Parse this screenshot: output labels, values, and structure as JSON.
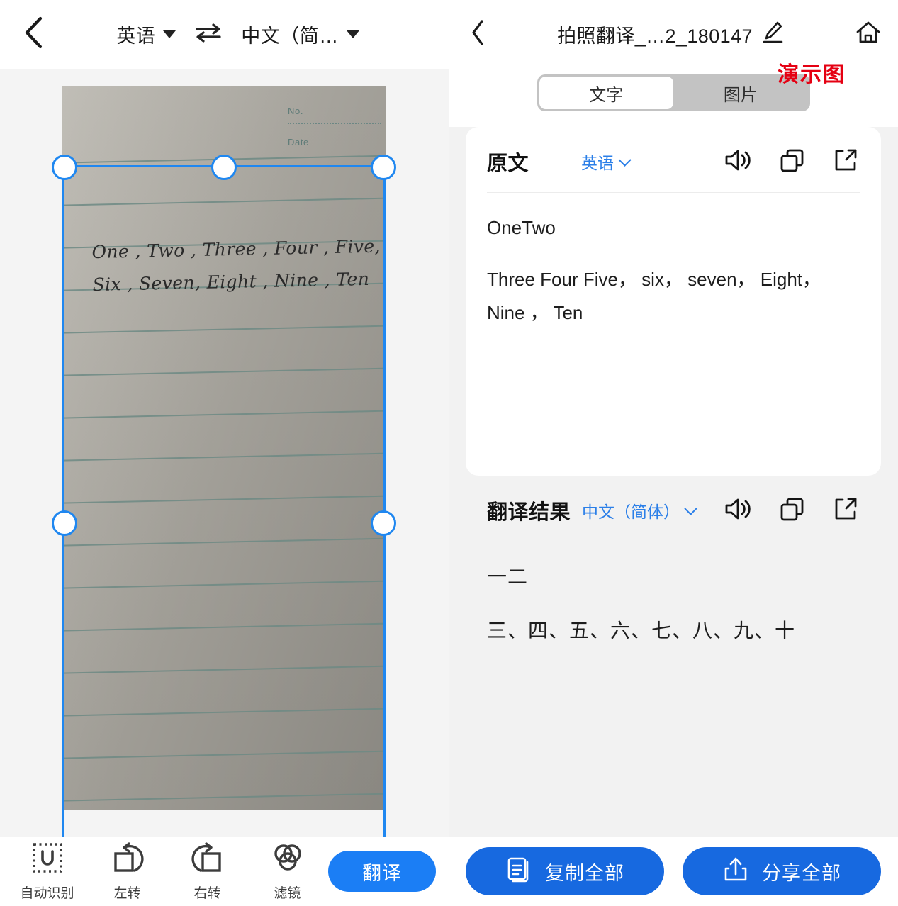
{
  "left": {
    "header": {
      "back_icon": "chevron-left-icon",
      "source_lang": "英语",
      "swap_icon": "swap-horizontal-icon",
      "target_lang": "中文（简…"
    },
    "photo": {
      "form_no_label": "No.",
      "form_date_label": "Date",
      "handwriting_line1": "One , Two , Three , Four , Five,",
      "handwriting_line2": "Six , Seven, Eight , Nine , Ten"
    },
    "toolbar": {
      "tools": [
        {
          "label": "自动识别",
          "icon": "auto-detect-icon"
        },
        {
          "label": "左转",
          "icon": "rotate-left-icon"
        },
        {
          "label": "右转",
          "icon": "rotate-right-icon"
        },
        {
          "label": "滤镜",
          "icon": "filter-icon"
        }
      ],
      "translate_label": "翻译"
    }
  },
  "right": {
    "header": {
      "back_icon": "chevron-left-icon",
      "title": "拍照翻译_…2_180147",
      "edit_icon": "pencil-edit-icon",
      "home_icon": "home-icon"
    },
    "watermark": "演示图",
    "segment": {
      "tabs": [
        {
          "label": "文字",
          "active": true
        },
        {
          "label": "图片",
          "active": false
        }
      ]
    },
    "source_card": {
      "title": "原文",
      "language": "英语",
      "actions": [
        "speaker-icon",
        "copy-icon",
        "share-external-icon"
      ],
      "paragraphs": [
        "OneTwo",
        "Three Four Five， six， seven， Eight， Nine ， Ten"
      ]
    },
    "result_card": {
      "title": "翻译结果",
      "language": "中文（简体）",
      "actions": [
        "speaker-icon",
        "copy-icon",
        "share-external-icon"
      ],
      "paragraphs": [
        "一二",
        "三、四、五、六、七、八、九、十"
      ]
    },
    "bottom": {
      "copy_all_label": "复制全部",
      "share_all_label": "分享全部"
    }
  },
  "colors": {
    "accent_blue": "#1b7ef5",
    "button_blue": "#1769e0",
    "link_blue": "#2b7fe8",
    "watermark_red": "#e50012",
    "crop_blue": "#1f87f0"
  }
}
